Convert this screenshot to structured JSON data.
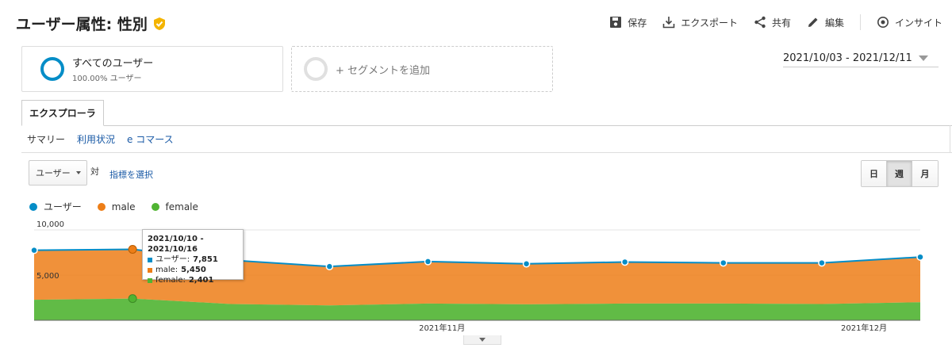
{
  "header": {
    "title": "ユーザー属性: 性別",
    "actions": [
      {
        "label": "保存",
        "icon": "save-icon"
      },
      {
        "label": "エクスポート",
        "icon": "export-icon"
      },
      {
        "label": "共有",
        "icon": "share-icon"
      },
      {
        "label": "編集",
        "icon": "pencil-icon"
      },
      {
        "label": "インサイト",
        "icon": "insight-icon"
      }
    ]
  },
  "segments": {
    "active": {
      "name": "すべてのユーザー",
      "sub": "100.00% ユーザー"
    },
    "add_label": "+ セグメントを追加"
  },
  "date_range": "2021/10/03 - 2021/12/11",
  "tabs": {
    "main": "エクスプローラ",
    "sub": [
      "サマリー",
      "利用状況",
      "e コマース"
    ]
  },
  "controls": {
    "metric_select": "ユーザー",
    "vs_label": "対",
    "metric_link": "指標を選択",
    "periods": [
      "日",
      "週",
      "月"
    ],
    "active_period": "週"
  },
  "colors": {
    "users": "#058dc7",
    "male": "#ed7e17",
    "female": "#50b432"
  },
  "chart_data": {
    "type": "area",
    "x": [
      "2021/10/03",
      "2021/10/10",
      "2021/10/17",
      "2021/10/24",
      "2021/10/31",
      "2021/11/07",
      "2021/11/14",
      "2021/11/21",
      "2021/11/28",
      "2021/12/05"
    ],
    "series": [
      {
        "name": "ユーザー",
        "values": [
          7750,
          7851,
          6650,
          5950,
          6500,
          6250,
          6450,
          6350,
          6350,
          7000
        ]
      },
      {
        "name": "male",
        "values": [
          5480,
          5450,
          4850,
          4300,
          4650,
          4480,
          4600,
          4500,
          4550,
          5000
        ]
      },
      {
        "name": "female",
        "values": [
          2270,
          2401,
          1800,
          1650,
          1850,
          1770,
          1850,
          1850,
          1800,
          2000
        ]
      }
    ],
    "y_ticks": [
      "10,000",
      "5,000"
    ],
    "x_labels": [
      "2021年11月",
      "2021年12月"
    ],
    "ylim": [
      0,
      10000
    ],
    "grid": true
  },
  "tooltip": {
    "title": "2021/10/10 - 2021/10/16",
    "rows": [
      {
        "label": "ユーザー:",
        "value": "7,851"
      },
      {
        "label": "male:",
        "value": "5,450"
      },
      {
        "label": "female:",
        "value": "2,401"
      }
    ]
  }
}
